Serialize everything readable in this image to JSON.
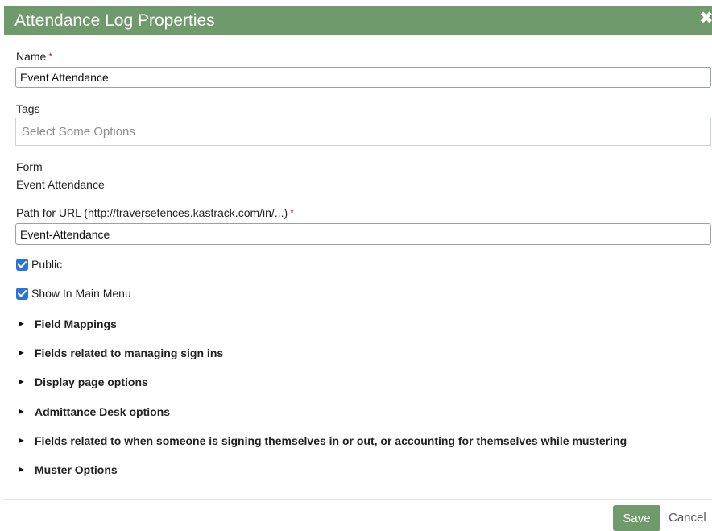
{
  "dialog": {
    "title": "Attendance Log Properties",
    "close_glyph": "✖"
  },
  "fields": {
    "name": {
      "label": "Name",
      "required_mark": "*",
      "value": "Event Attendance"
    },
    "tags": {
      "label": "Tags",
      "placeholder": "Select Some Options"
    },
    "form": {
      "label": "Form",
      "value": "Event Attendance"
    },
    "path": {
      "label": "Path for URL (http://traversefences.kastrack.com/in/...)",
      "required_mark": "*",
      "value": "Event-Attendance"
    }
  },
  "checkboxes": [
    {
      "label": "Public",
      "checked": true
    },
    {
      "label": "Show In Main Menu",
      "checked": true
    }
  ],
  "sections": [
    {
      "label": "Field Mappings"
    },
    {
      "label": "Fields related to managing sign ins"
    },
    {
      "label": "Display page options"
    },
    {
      "label": "Admittance Desk options"
    },
    {
      "label": "Fields related to when someone is signing themselves in or out, or accounting for themselves while mustering"
    },
    {
      "label": "Muster Options"
    }
  ],
  "expand_glyph": "►",
  "footer": {
    "save_label": "Save",
    "cancel_label": "Cancel"
  },
  "colors": {
    "header_green": "#6e9a6c",
    "checkbox_blue": "#2a73d8",
    "required_red": "#cc2222"
  }
}
